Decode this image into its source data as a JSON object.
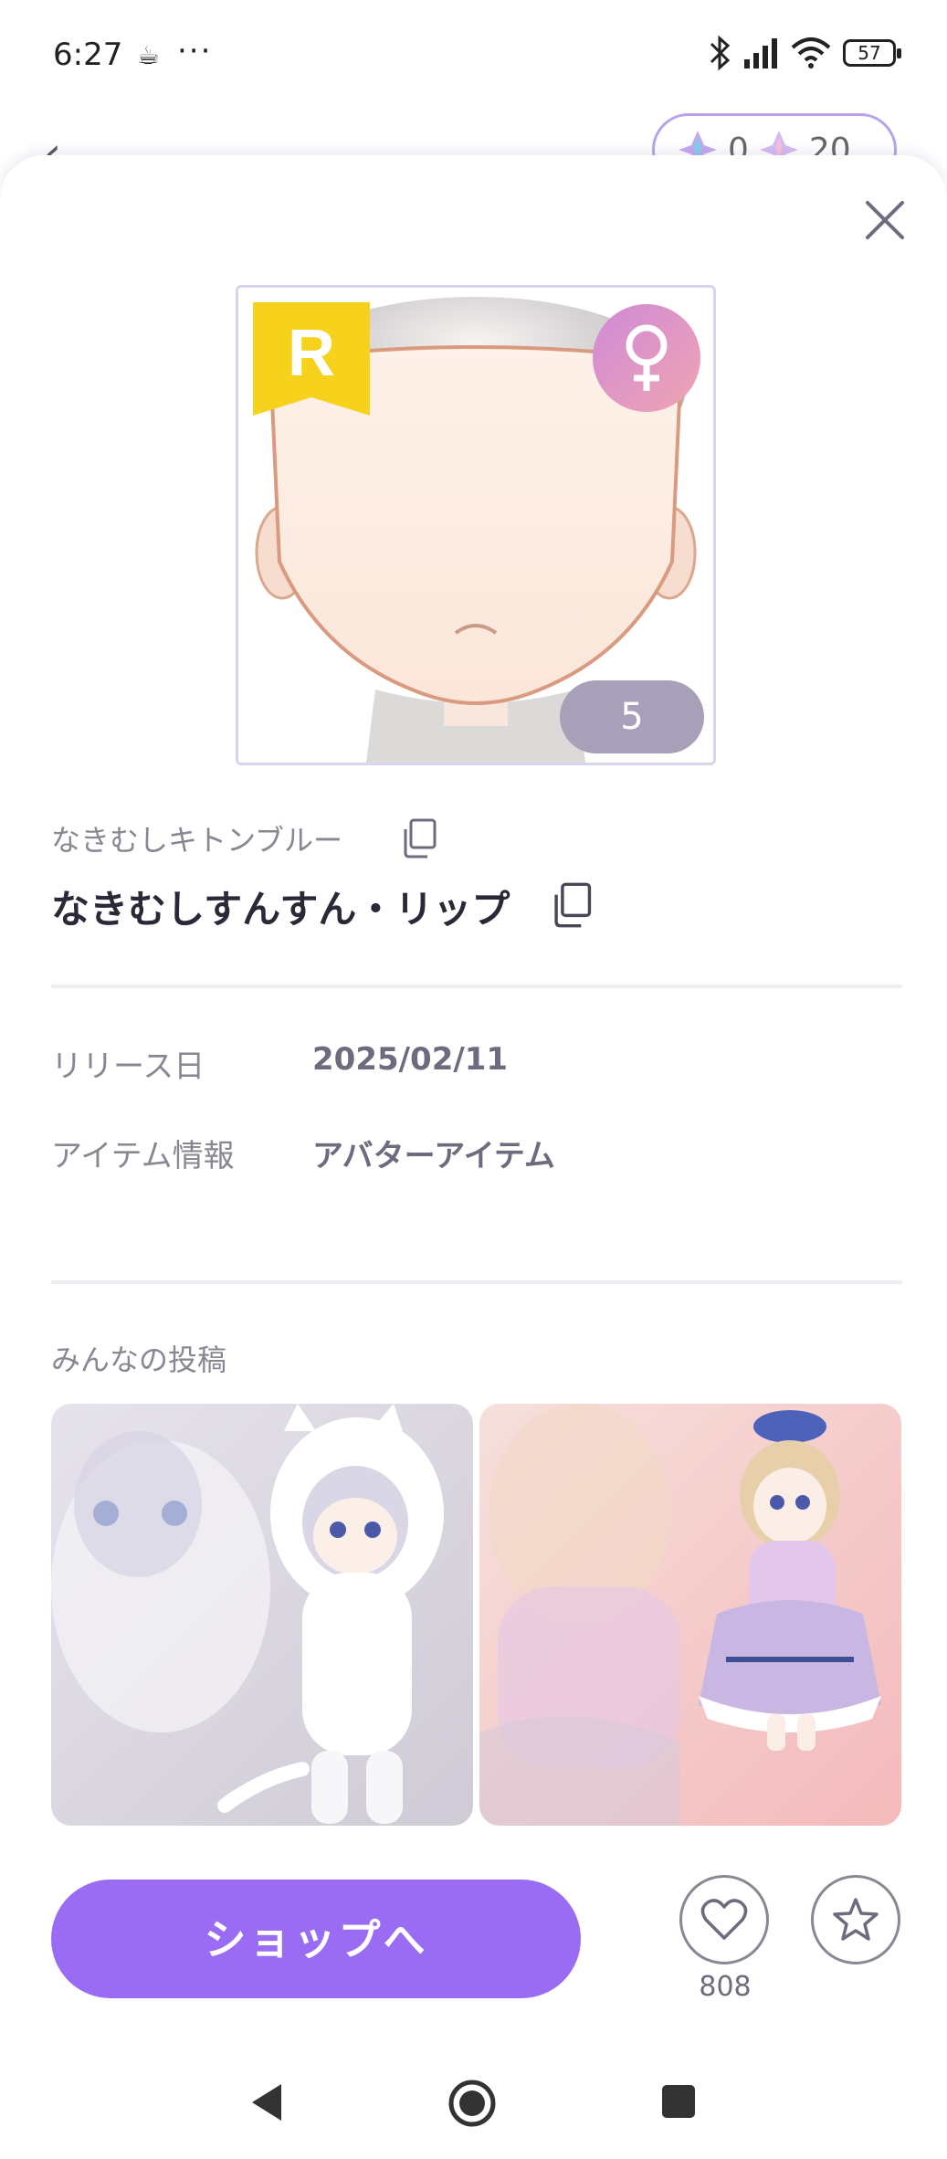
{
  "status_bar": {
    "time": "6:27",
    "battery": "57"
  },
  "background_header": {
    "currency_a": "0",
    "currency_b": "20"
  },
  "item": {
    "rarity": "R",
    "count": "5",
    "sub_name": "なきむしキトンブルー",
    "name": "なきむしすんすん・リップ"
  },
  "info": {
    "release_label": "リリース日",
    "release_value": "2025/02/11",
    "type_label": "アイテム情報",
    "type_value": "アバターアイテム"
  },
  "posts": {
    "title": "みんなの投稿"
  },
  "actions": {
    "shop_label": "ショップへ",
    "like_count": "808"
  },
  "colors": {
    "accent": "#9a6cf3",
    "rarity": "#f7d21d",
    "count_badge": "#a8a0b9"
  },
  "icons": [
    "coffee-icon",
    "bluetooth-icon",
    "signal-icon",
    "wifi-icon",
    "battery-icon",
    "back-icon",
    "close-icon",
    "copy-icon",
    "female-icon",
    "heart-icon",
    "star-icon",
    "nav-back-icon",
    "nav-home-icon",
    "nav-recents-icon"
  ]
}
